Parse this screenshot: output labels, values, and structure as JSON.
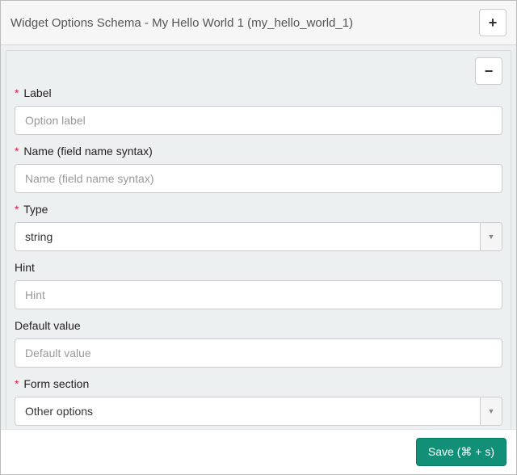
{
  "header": {
    "title": "Widget Options Schema - My Hello World 1 (my_hello_world_1)"
  },
  "option": {
    "label": {
      "label": "Label",
      "placeholder": "Option label",
      "value": "",
      "required": true
    },
    "name": {
      "label": "Name (field name syntax)",
      "placeholder": "Name (field name syntax)",
      "value": "",
      "required": true
    },
    "type": {
      "label": "Type",
      "value": "string",
      "required": true
    },
    "hint": {
      "label": "Hint",
      "placeholder": "Hint",
      "value": "",
      "required": false
    },
    "default_value": {
      "label": "Default value",
      "placeholder": "Default value",
      "value": "",
      "required": false
    },
    "form_section": {
      "label": "Form section",
      "value": "Other options",
      "required": true
    }
  },
  "footer": {
    "save_label": "Save (⌘ + s)"
  },
  "glyphs": {
    "plus": "+",
    "minus": "−",
    "caret": "▼",
    "asterisk": "*"
  }
}
